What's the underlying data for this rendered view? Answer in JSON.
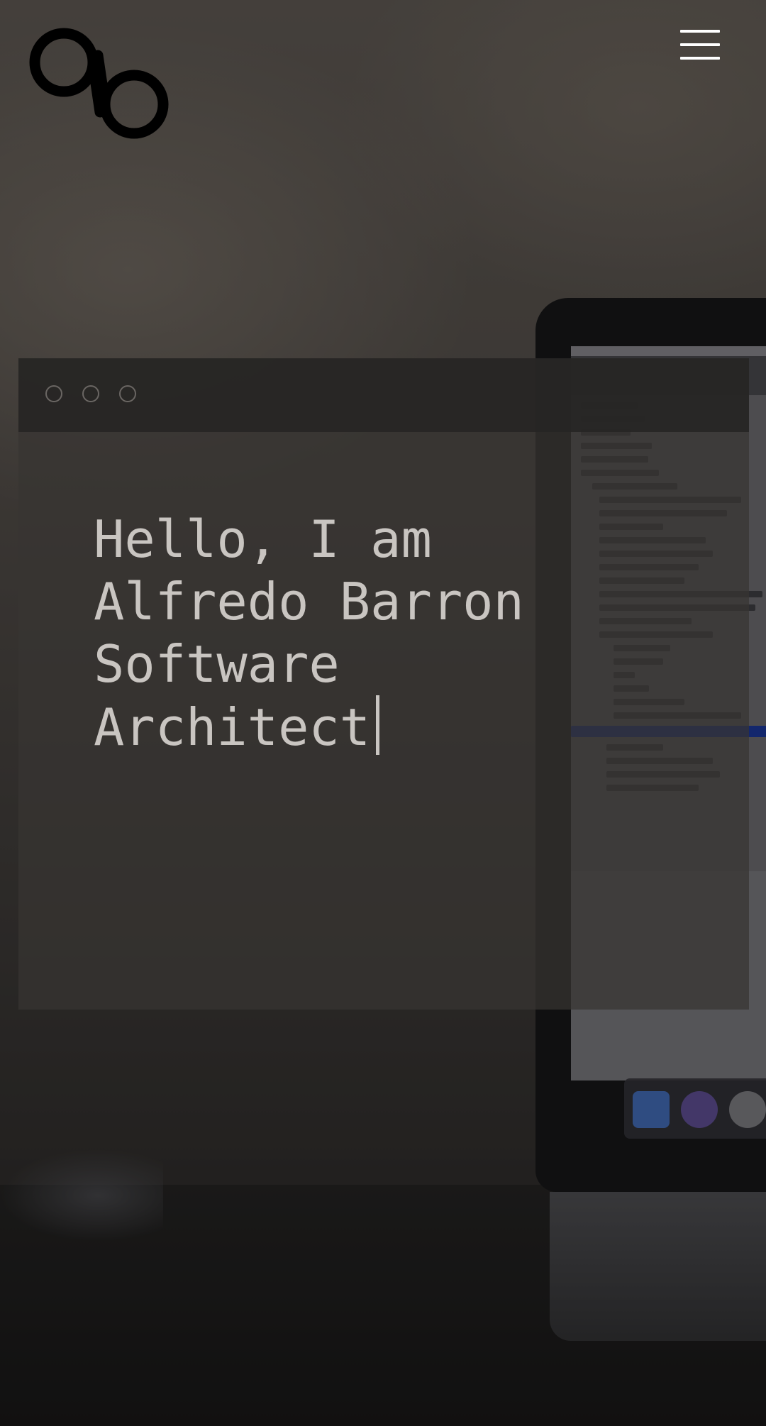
{
  "header": {
    "logo_icon": "ab-monogram-logo",
    "menu_icon": "hamburger-menu-icon"
  },
  "terminal": {
    "window_controls": [
      "circle-outline-icon",
      "circle-outline-icon",
      "circle-outline-icon"
    ],
    "lines": [
      "Hello, I am",
      "Alfredo Barron",
      "Software",
      "Architect"
    ],
    "cursor": "|"
  },
  "colors": {
    "text": "#c9c5c1",
    "logo": "#000000",
    "menu_icon": "#ffffff"
  }
}
